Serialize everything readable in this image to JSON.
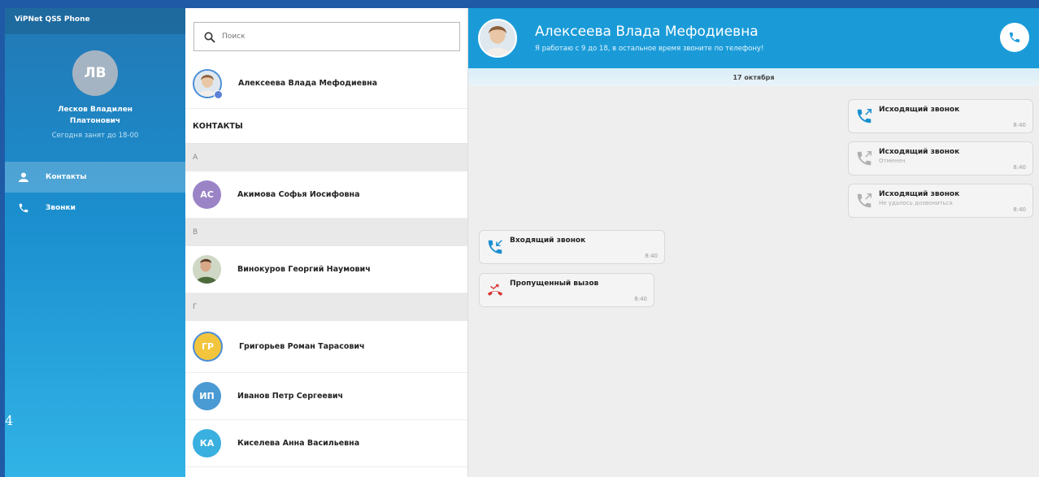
{
  "app": {
    "title": "ViPNet QSS Phone",
    "page_number": "4"
  },
  "profile": {
    "initials": "ЛВ",
    "name": "Лесков Владилен Платонович",
    "status": "Сегодня занят до 18-00"
  },
  "nav": {
    "contacts": {
      "label": "Контакты",
      "icon": "person-icon"
    },
    "calls": {
      "label": "Звонки",
      "icon": "phone-icon"
    }
  },
  "search": {
    "placeholder": "Поиск",
    "value": ""
  },
  "favorites": [
    {
      "name": "Алексеева Влада Мефодиевна",
      "avatar": "photo"
    }
  ],
  "contacts_header": "КОНТАКТЫ",
  "groups": [
    {
      "letter": "А",
      "contacts": [
        {
          "initials": "АС",
          "name": "Акимова Софья Иосифовна",
          "color": "#9b84c6"
        }
      ]
    },
    {
      "letter": "В",
      "contacts": [
        {
          "initials": "",
          "name": "Винокуров Георгий Наумович",
          "color": "#6f8a5a"
        }
      ]
    },
    {
      "letter": "Г",
      "contacts": [
        {
          "initials": "ГР",
          "name": "Григорьев Роман Тарасович",
          "color": "#f2c53d"
        },
        {
          "initials": "ИП",
          "name": "Иванов Петр Сергеевич",
          "color": "#4a9ad3"
        },
        {
          "initials": "КА",
          "name": "Киселева Анна Васильевна",
          "color": "#3ab0e0"
        }
      ]
    }
  ],
  "chat": {
    "name": "Алексеева Влада Мефодиевна",
    "status": "Я работаю с 9 до 18, в остальное время звоните по телефону!",
    "date": "17 октября",
    "messages": [
      {
        "title": "Исходящий звонок",
        "sub": "",
        "time": "8:40",
        "icon": "outgoing-call-icon"
      },
      {
        "title": "Исходящий звонок",
        "sub": "Отменен",
        "time": "8:40",
        "icon": "outgoing-call-cancelled-icon"
      },
      {
        "title": "Исходящий звонок",
        "sub": "Не удалось дозвониться",
        "time": "8:40",
        "icon": "outgoing-call-failed-icon"
      },
      {
        "title": "Входящий звонок",
        "sub": "",
        "time": "8:40",
        "icon": "incoming-call-icon"
      },
      {
        "title": "Пропущенный вызов",
        "sub": "",
        "time": "8:40",
        "icon": "missed-call-icon"
      }
    ]
  },
  "colors": {
    "accent": "#1a9bd8",
    "sidebar": "#2378b4",
    "missed": "#d9322e"
  }
}
